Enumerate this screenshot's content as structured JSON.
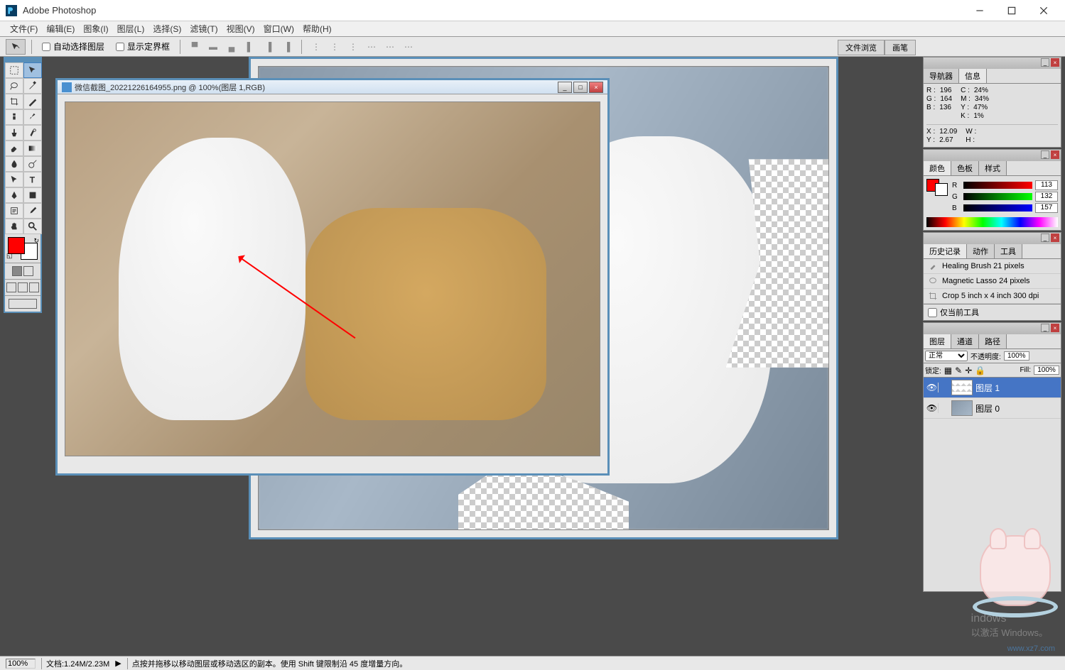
{
  "titlebar": {
    "app_name": "Adobe Photoshop"
  },
  "menu": {
    "items": [
      "文件(F)",
      "编辑(E)",
      "图象(I)",
      "图层(L)",
      "选择(S)",
      "滤镜(T)",
      "视图(V)",
      "窗口(W)",
      "帮助(H)"
    ]
  },
  "options": {
    "auto_select": "自动选择图层",
    "show_bounds": "显示定界框"
  },
  "file_tabs": [
    "文件浏览",
    "画笔"
  ],
  "doc_front": {
    "title": "微信截图_20221226164955.png @ 100%(图层 1,RGB)"
  },
  "panels": {
    "navigator": {
      "tabs": [
        "导航器",
        "信息"
      ]
    },
    "color": {
      "tabs": [
        "颜色",
        "色板",
        "样式"
      ]
    },
    "history": {
      "tabs": [
        "历史记录",
        "动作",
        "工具"
      ]
    },
    "layers": {
      "tabs": [
        "图层",
        "通道",
        "路径"
      ]
    }
  },
  "info": {
    "r_label": "R :",
    "r_val": "196",
    "g_label": "G :",
    "g_val": "164",
    "b_label": "B :",
    "b_val": "136",
    "c_label": "C :",
    "c_val": "24%",
    "m_label": "M :",
    "m_val": "34%",
    "y_label": "Y :",
    "y_val": "47%",
    "k_label": "K :",
    "k_val": "1%",
    "x_label": "X :",
    "x_val": "12.09",
    "ypos_label": "Y :",
    "ypos_val": "2.67",
    "w_label": "W :",
    "h_label": "H :"
  },
  "color_panel": {
    "r": "113",
    "g": "132",
    "b": "157",
    "r_label": "R",
    "g_label": "G",
    "b_label": "B"
  },
  "history_items": [
    {
      "icon": "brush",
      "label": "Healing Brush 21 pixels"
    },
    {
      "icon": "lasso",
      "label": "Magnetic Lasso 24 pixels"
    },
    {
      "icon": "crop",
      "label": "Crop 5 inch x 4 inch 300 dpi"
    }
  ],
  "history_footer": "仅当前工具",
  "layers_panel": {
    "mode": "正常",
    "opacity_label": "不透明度:",
    "opacity": "100%",
    "lock_label": "锁定:",
    "fill_label": "Fill:",
    "fill": "100%",
    "layers": [
      {
        "name": "图层 1",
        "selected": true
      },
      {
        "name": "图层 0",
        "selected": false
      }
    ]
  },
  "status": {
    "zoom": "100%",
    "doc_size": "文档:1.24M/2.23M",
    "hint": "点按并拖移以移动图层或移动选区的副本。使用 Shift 键限制沿 45 度增量方向。"
  },
  "activate": {
    "line2": "以激活 Windows。"
  },
  "watermark": "www.xz7.com"
}
